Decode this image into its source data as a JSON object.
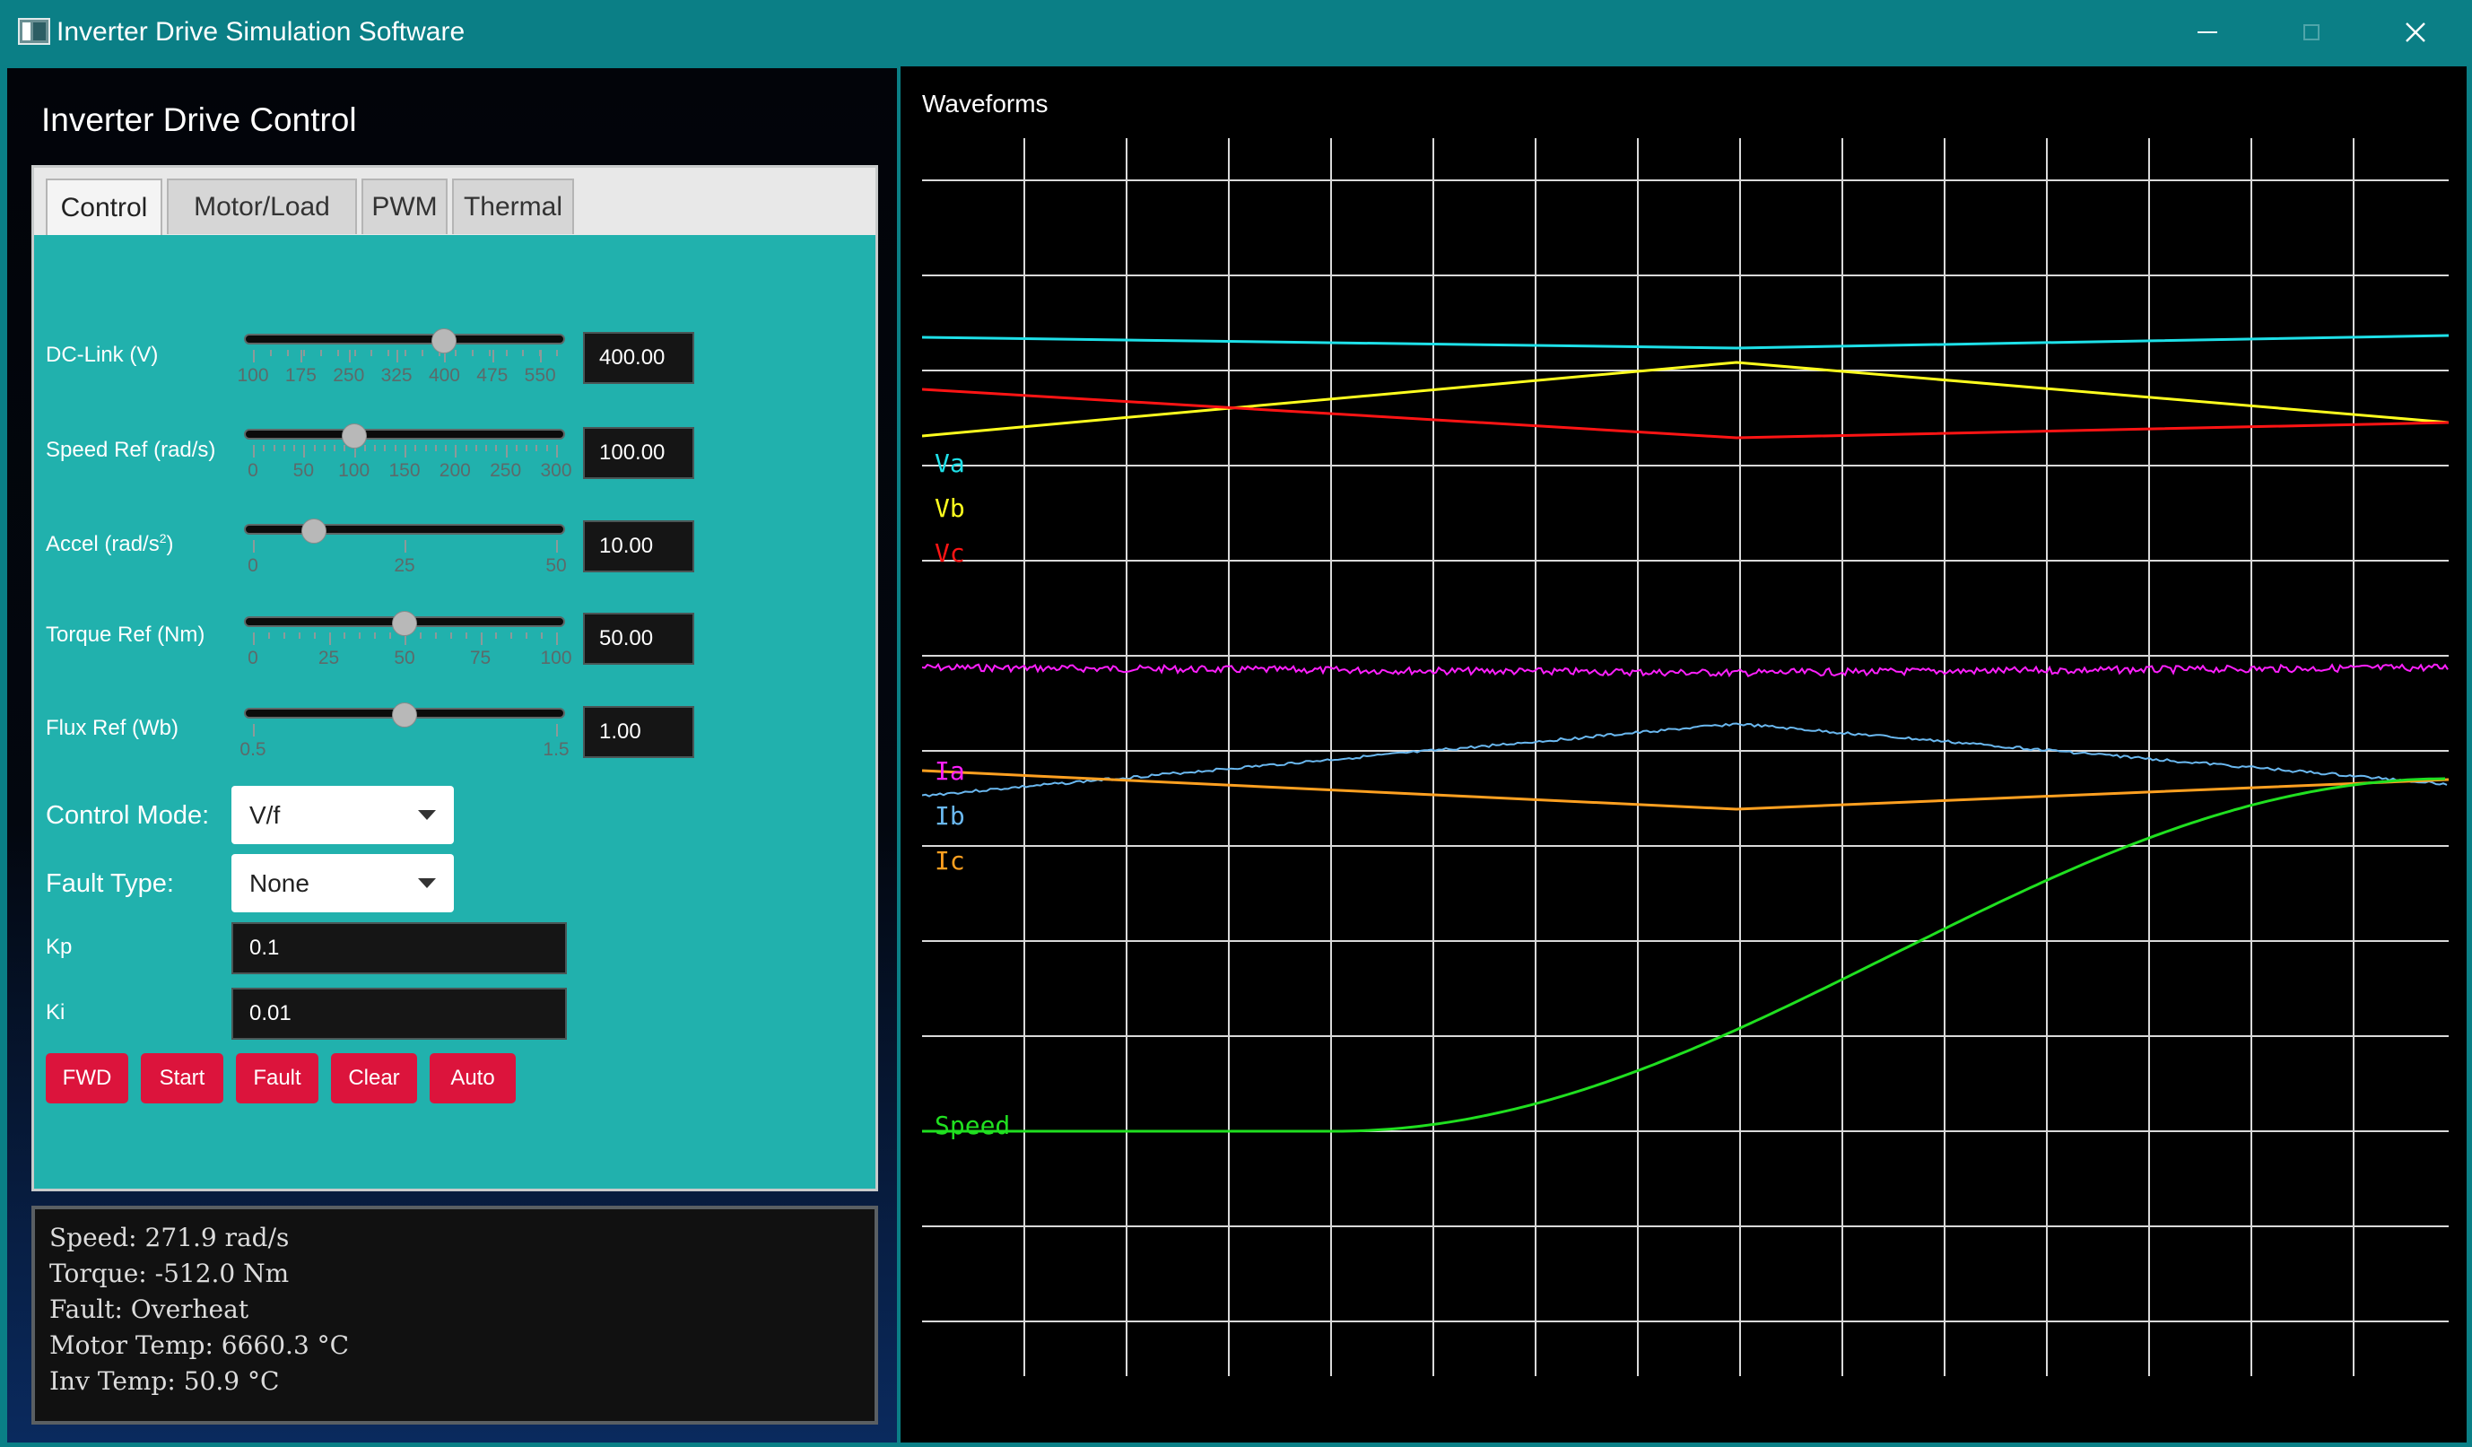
{
  "window": {
    "title": "Inverter Drive Simulation Software",
    "icon": "app-window-icon"
  },
  "control_panel": {
    "heading": "Inverter Drive Control",
    "tabs": [
      {
        "label": "Control",
        "active": true
      },
      {
        "label": "Motor/Load",
        "active": false
      },
      {
        "label": "PWM",
        "active": false
      },
      {
        "label": "Thermal",
        "active": false
      }
    ],
    "sliders": {
      "dc_link": {
        "label": "DC-Link (V)",
        "min": 100,
        "max": 575,
        "value": 400,
        "value_text": "400.00",
        "ticks": [
          "100",
          "175",
          "250",
          "325",
          "400",
          "475",
          "550"
        ],
        "tick_values": [
          100,
          175,
          250,
          325,
          400,
          475,
          550
        ],
        "minor": 18
      },
      "speed_ref": {
        "label": "Speed Ref (rad/s)",
        "min": 0,
        "max": 300,
        "value": 100,
        "value_text": "100.00",
        "ticks": [
          "0",
          "50",
          "100",
          "150",
          "200",
          "250",
          "300"
        ],
        "tick_values": [
          0,
          50,
          100,
          150,
          200,
          250,
          300
        ],
        "minor": 30
      },
      "accel": {
        "label": "Accel (rad/s",
        "label_sup": "2",
        "label_end": ")",
        "min": 0,
        "max": 50,
        "value": 10,
        "value_text": "10.00",
        "ticks": [
          "0",
          "25",
          "50"
        ],
        "tick_values": [
          0,
          25,
          50
        ],
        "minor": 0
      },
      "torque_ref": {
        "label": "Torque Ref (Nm)",
        "min": 0,
        "max": 100,
        "value": 50,
        "value_text": "50.00",
        "ticks": [
          "0",
          "25",
          "50",
          "75",
          "100"
        ],
        "tick_values": [
          0,
          25,
          50,
          75,
          100
        ],
        "minor": 20
      },
      "flux_ref": {
        "label": "Flux Ref (Wb)",
        "min": 0.5,
        "max": 1.5,
        "value": 1.0,
        "value_text": "1.00",
        "ticks": [
          "0.5",
          "1.5"
        ],
        "tick_values": [
          0.5,
          1.5
        ],
        "minor": 0
      }
    },
    "control_mode": {
      "label": "Control Mode:",
      "selected": "V/f"
    },
    "fault_type": {
      "label": "Fault Type:",
      "selected": "None"
    },
    "kp": {
      "label": "Kp",
      "value": "0.1"
    },
    "ki": {
      "label": "Ki",
      "value": "0.01"
    },
    "buttons": {
      "fwd": "FWD",
      "start": "Start",
      "fault": "Fault",
      "clear": "Clear",
      "auto": "Auto"
    },
    "accent_color": "#dc143c",
    "panel_color": "#21b1ad"
  },
  "status": {
    "speed": "Speed: 271.9 rad/s",
    "torque": "Torque: -512.0 Nm",
    "fault": "Fault: Overheat",
    "motor_temp": "Motor Temp: 6660.3 °C",
    "inv_temp": "Inv Temp: 50.9 °C"
  },
  "waveforms": {
    "title": "Waveforms",
    "labels": {
      "va": "Va",
      "vb": "Vb",
      "vc": "Vc",
      "ia": "Ia",
      "ib": "Ib",
      "ic": "Ic",
      "speed": "Speed"
    },
    "colors": {
      "va": "#1ee0e8",
      "vb": "#ffff1e",
      "vc": "#ff1414",
      "ia": "#ff20ff",
      "ib": "#6ab8f0",
      "ic": "#ffa020",
      "speed": "#20e020"
    }
  }
}
